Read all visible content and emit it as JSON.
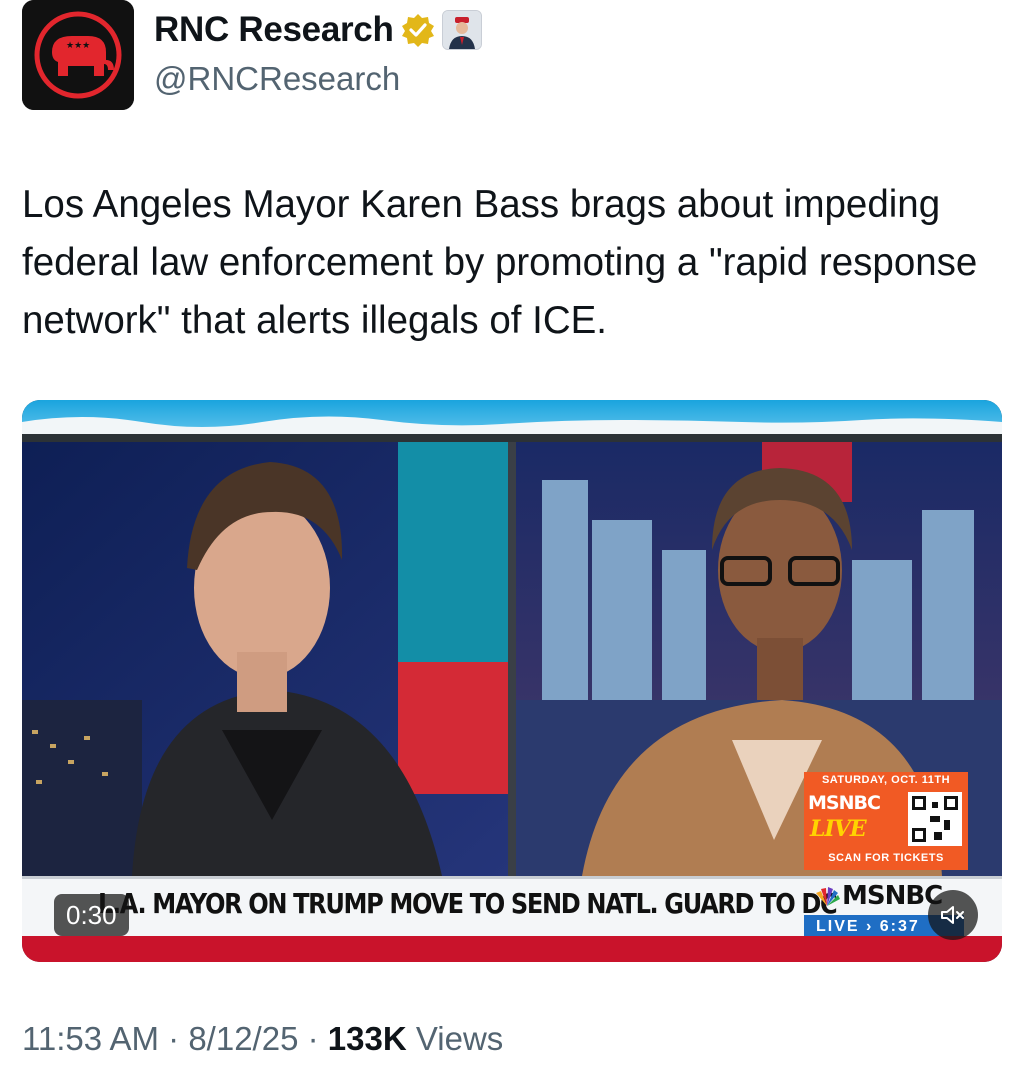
{
  "author": {
    "display_name": "RNC Research",
    "handle": "@RNCResearch",
    "verified_badge_color": "#e2b719",
    "avatar_colors": {
      "background": "#111111",
      "ring": "#e2262d"
    }
  },
  "tweet": {
    "text": "Los Angeles Mayor Karen Bass brags about impeding federal law enforcement by promoting a \"rapid response network\" that alerts illegals of ICE."
  },
  "video": {
    "timestamp": "0:30",
    "chyron_prefix": "L.A.",
    "chyron_text": "MAYOR ON TRUMP MOVE TO SEND NATL. GUARD TO DC",
    "network_logo": "MSNBC",
    "network_live_text": "LIVE › 6:37",
    "promo": {
      "date_text": "SATURDAY, OCT. 11TH",
      "brand": "MSNBC",
      "live_text": "LIVE",
      "scan_text": "SCAN FOR TICKETS"
    },
    "mute_icon": "speaker-muted-icon"
  },
  "meta": {
    "time": "11:53 AM",
    "date": "8/12/25",
    "views_count": "133K",
    "views_label": "Views"
  }
}
